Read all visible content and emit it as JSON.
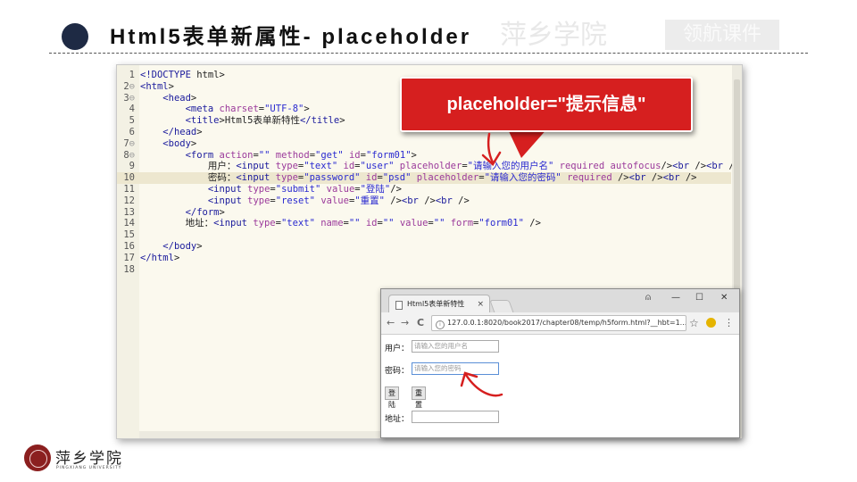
{
  "slide": {
    "title": "Html5表单新属性- placeholder",
    "watermark_text": "萍乡学院",
    "watermark_box": "领航课件"
  },
  "callout": {
    "text": "placeholder=\"提示信息\""
  },
  "editor": {
    "lines": [
      {
        "n": "1",
        "fold": "",
        "text": "<!DOCTYPE html>"
      },
      {
        "n": "2",
        "fold": "⊖",
        "text": "<html>"
      },
      {
        "n": "3",
        "fold": "⊖",
        "text": "    <head>"
      },
      {
        "n": "4",
        "fold": "",
        "text": "        <meta charset=\"UTF-8\">"
      },
      {
        "n": "5",
        "fold": "",
        "text": "        <title>Html5表单新特性</title>"
      },
      {
        "n": "6",
        "fold": "",
        "text": "    </head>"
      },
      {
        "n": "7",
        "fold": "⊖",
        "text": "    <body>"
      },
      {
        "n": "8",
        "fold": "⊖",
        "text": "        <form action=\"\" method=\"get\" id=\"form01\">"
      },
      {
        "n": "9",
        "fold": "",
        "text": "            用户：<input type=\"text\" id=\"user\" placeholder=\"请输入您的用户名\" required autofocus/><br /><br />"
      },
      {
        "n": "10",
        "fold": "",
        "text": "            密码：<input type=\"password\" id=\"psd\" placeholder=\"请输入您的密码\" required /><br /><br />"
      },
      {
        "n": "11",
        "fold": "",
        "text": "            <input type=\"submit\" value=\"登陆\"/>"
      },
      {
        "n": "12",
        "fold": "",
        "text": "            <input type=\"reset\" value=\"重置\" /><br /><br />"
      },
      {
        "n": "13",
        "fold": "",
        "text": "        </form>"
      },
      {
        "n": "14",
        "fold": "",
        "text": "        地址：<input type=\"text\" name=\"\" id=\"\" value=\"\" form=\"form01\" />"
      },
      {
        "n": "15",
        "fold": "",
        "text": ""
      },
      {
        "n": "16",
        "fold": "",
        "text": "    </body>"
      },
      {
        "n": "17",
        "fold": "",
        "text": "</html>"
      },
      {
        "n": "18",
        "fold": "",
        "text": ""
      }
    ],
    "highlighted_line": "10",
    "selected_fragment": "placeholder=\"请输入您的密码\""
  },
  "browser": {
    "tab_title": "Html5表单新特性",
    "tab_close": "×",
    "window_controls": {
      "account": "⍝",
      "minimize": "—",
      "maximize": "☐",
      "close": "✕"
    },
    "nav": {
      "back": "←",
      "forward": "→",
      "reload": "C"
    },
    "url": "127.0.0.1:8020/book2017/chapter08/temp/h5form.html?__hbt=1...",
    "form": {
      "user_label": "用户：",
      "user_placeholder": "请输入您的用户名",
      "password_label": "密码：",
      "password_placeholder": "请输入您的密码",
      "submit_label": "登陆",
      "reset_label": "重置",
      "address_label": "地址："
    }
  },
  "logo": {
    "name": "萍乡学院",
    "subtitle": "PINGXIANG UNIVERSITY"
  },
  "colors": {
    "callout_red": "#d61f1f",
    "title_dot": "#1e2a44",
    "editor_bg": "#fbf9ee",
    "selection": "#cfe8b8",
    "logo_red": "#8b1f1f"
  }
}
